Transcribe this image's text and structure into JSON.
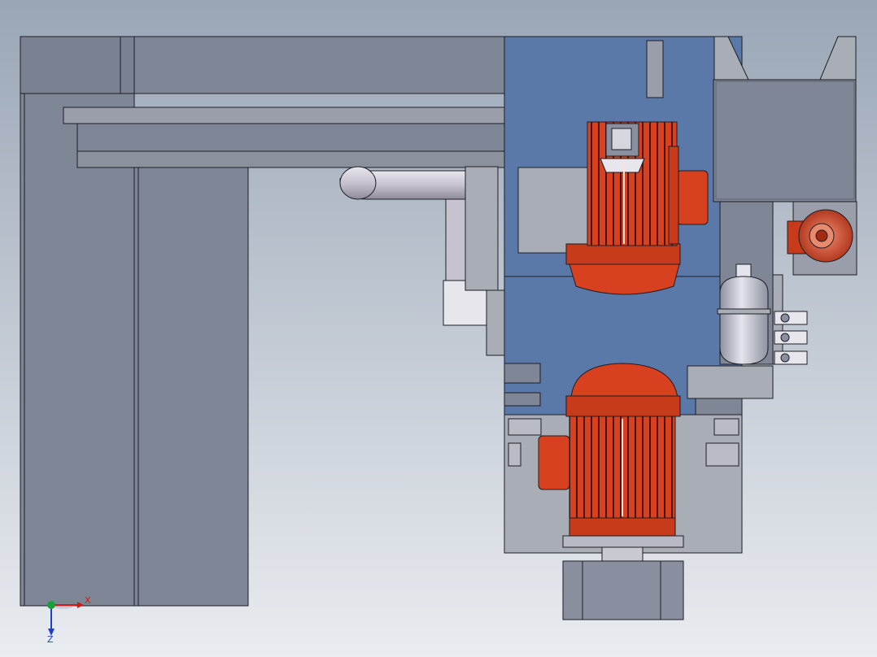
{
  "viewport": {
    "background_top": "#9aa6b6",
    "background_bottom": "#e9ecf0"
  },
  "colors": {
    "steel": "#7f8797",
    "steel_dark": "#6f7787",
    "steel_light": "#a9adb6",
    "panel_blue": "#5a78a8",
    "motor_red": "#d8411f",
    "motor_red_dark": "#a52a12",
    "pipe": "#cfcbd6",
    "outline": "#1e1e24",
    "base_block": "#8a8fa0"
  },
  "components": [
    "gantry-frame",
    "horizontal-beam",
    "upper-motor",
    "lower-motor",
    "side-motor",
    "accumulator-tank",
    "pipe-elbow",
    "motor-base-block",
    "valve-block"
  ],
  "triad": {
    "x_label": "X",
    "z_label": "Z",
    "x_color": "#d11a1a",
    "z_color": "#1a3fd1",
    "origin_color": "#1aa03a"
  }
}
